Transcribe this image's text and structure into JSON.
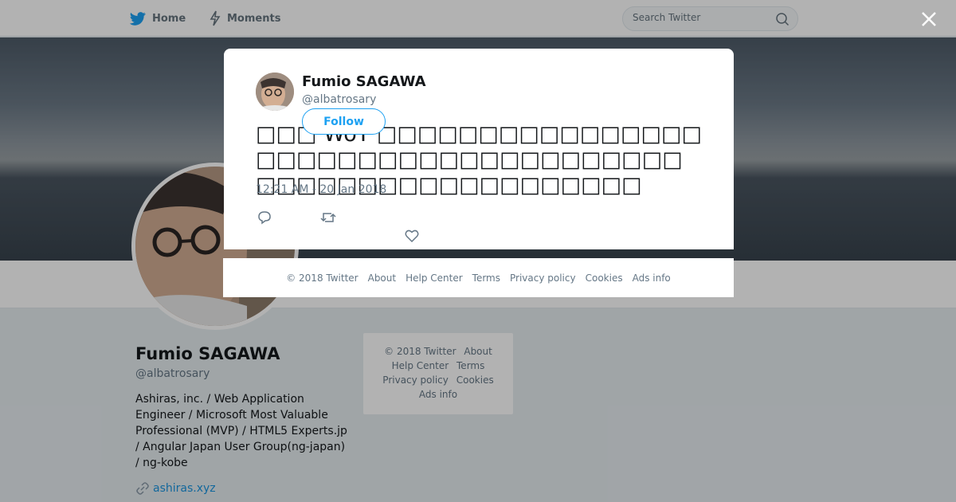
{
  "topbar": {
    "home_label": "Home",
    "moments_label": "Moments",
    "search_placeholder": "Search Twitter"
  },
  "profile": {
    "name": "Fumio SAGAWA",
    "handle": "@albatrosary",
    "bio": "Ashiras, inc. / Web Application Engineer / Microsoft Most Valuable Professional (MVP) / HTML5 Experts.jp / Angular Japan User Group(ng-japan) / ng-kobe",
    "link_text": "ashiras.xyz"
  },
  "side_footer": {
    "copyright": "© 2018 Twitter",
    "about": "About",
    "help": "Help Center",
    "terms": "Terms",
    "privacy": "Privacy policy",
    "cookies": "Cookies",
    "ads": "Ads info"
  },
  "tweet": {
    "name": "Fumio SAGAWA",
    "handle": "@albatrosary",
    "follow_label": "Follow",
    "text": "□□□ WoT □□□□□□□□□□□□□□□□□□□□□□□□□□□□□□□□□□□□□□□□□□□□□□□□□□□□□□□□",
    "timestamp": "12:21 AM - 20 Jan 2018"
  },
  "modal_footer": {
    "copyright": "© 2018 Twitter",
    "about": "About",
    "help": "Help Center",
    "terms": "Terms",
    "privacy": "Privacy policy",
    "cookies": "Cookies",
    "ads": "Ads info"
  },
  "colors": {
    "twitter_blue": "#1da1f2",
    "link_blue": "#1b95e0",
    "muted": "#657786"
  },
  "icons": [
    "twitter-bird-icon",
    "lightning-icon",
    "search-icon",
    "close-icon",
    "reply-icon",
    "retweet-icon",
    "heart-icon",
    "link-icon"
  ]
}
